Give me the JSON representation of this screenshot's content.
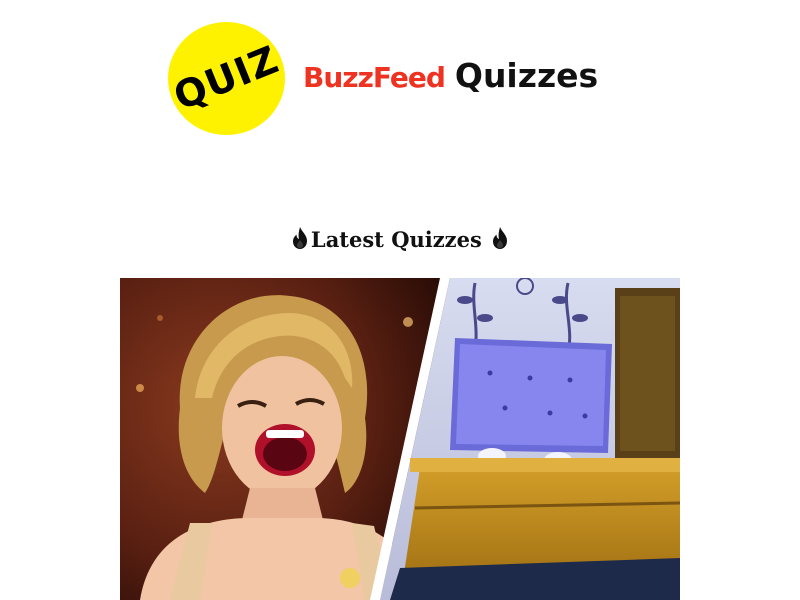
{
  "header": {
    "badge_text": "QUIZ",
    "brand_buzzfeed": "BuzzFeed",
    "brand_quizzes": "Quizzes",
    "brand_color": "#ee3322",
    "badge_color": "#fff200"
  },
  "section": {
    "title": "Latest Quizzes",
    "icon": "fire-icon"
  },
  "feature_image": {
    "icon": "quiz-thumbnail"
  }
}
